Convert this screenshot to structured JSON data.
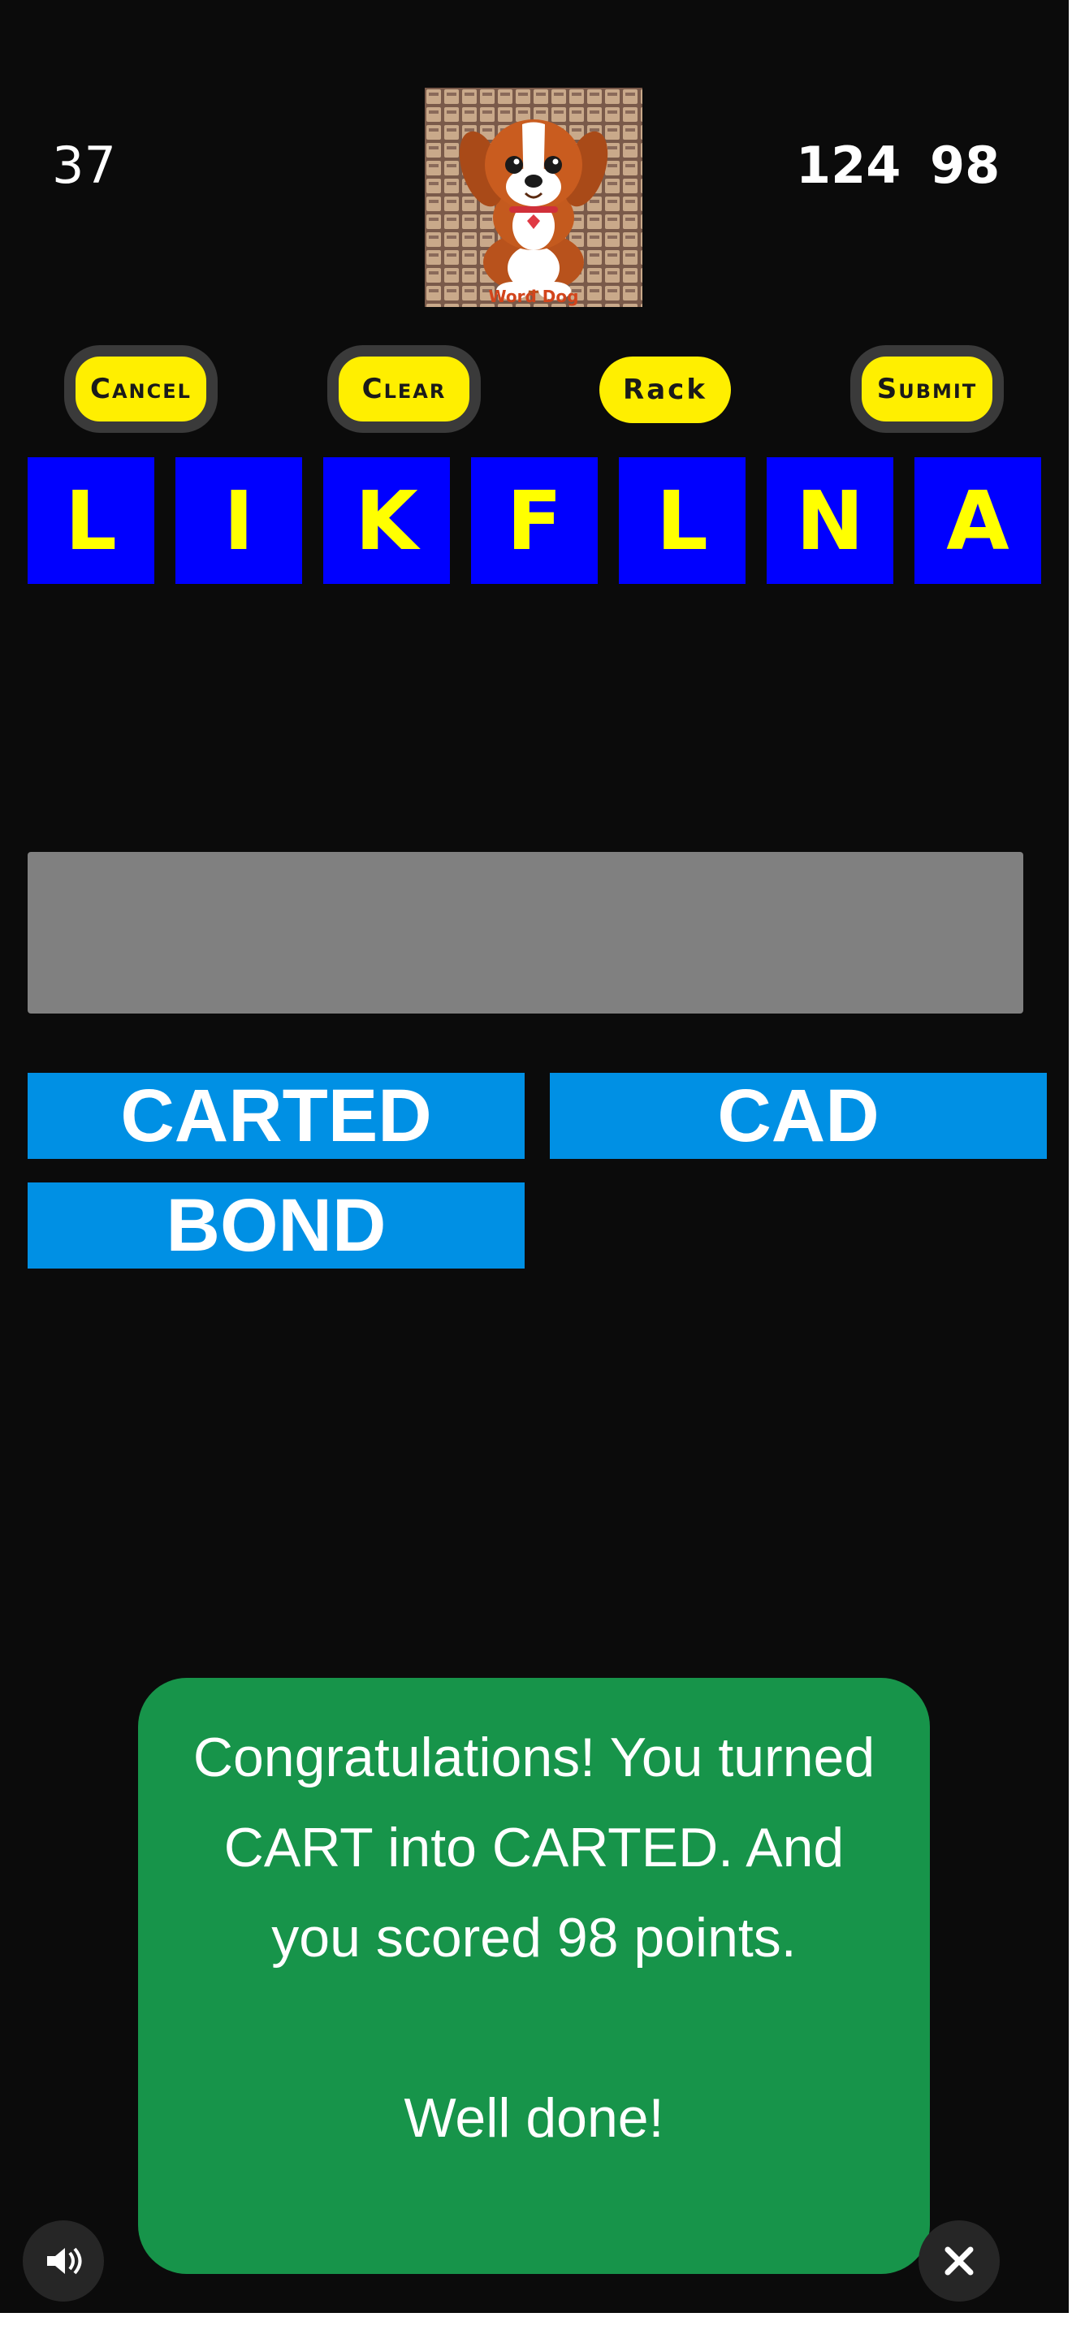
{
  "header": {
    "left_number": "37",
    "right_number_a": "124",
    "right_number_b": "98",
    "logo_text": "Word Dog",
    "logo_icon": "cartoon-dog"
  },
  "controls": {
    "cancel": "Cancel",
    "clear": "Clear",
    "rack": "Rack",
    "submit": "Submit"
  },
  "rack_tiles": [
    "L",
    "I",
    "K",
    "F",
    "L",
    "N",
    "A"
  ],
  "words": [
    "CARTED",
    "CAD",
    "BOND"
  ],
  "message": {
    "text": "Congratulations! You turned CART into CARTED. And you scored 98 points.\n\nWell done!"
  },
  "bottom": {
    "left_icon": "sound-icon",
    "right_icon": "close-icon"
  },
  "colors": {
    "background": "#0b0b0b",
    "tile_bg": "#0000ff",
    "tile_fg": "#ffff00",
    "button_bg": "#ffef00",
    "word_bg": "#0090e4",
    "slot_bg": "#808080",
    "modal_bg": "#17944a"
  }
}
